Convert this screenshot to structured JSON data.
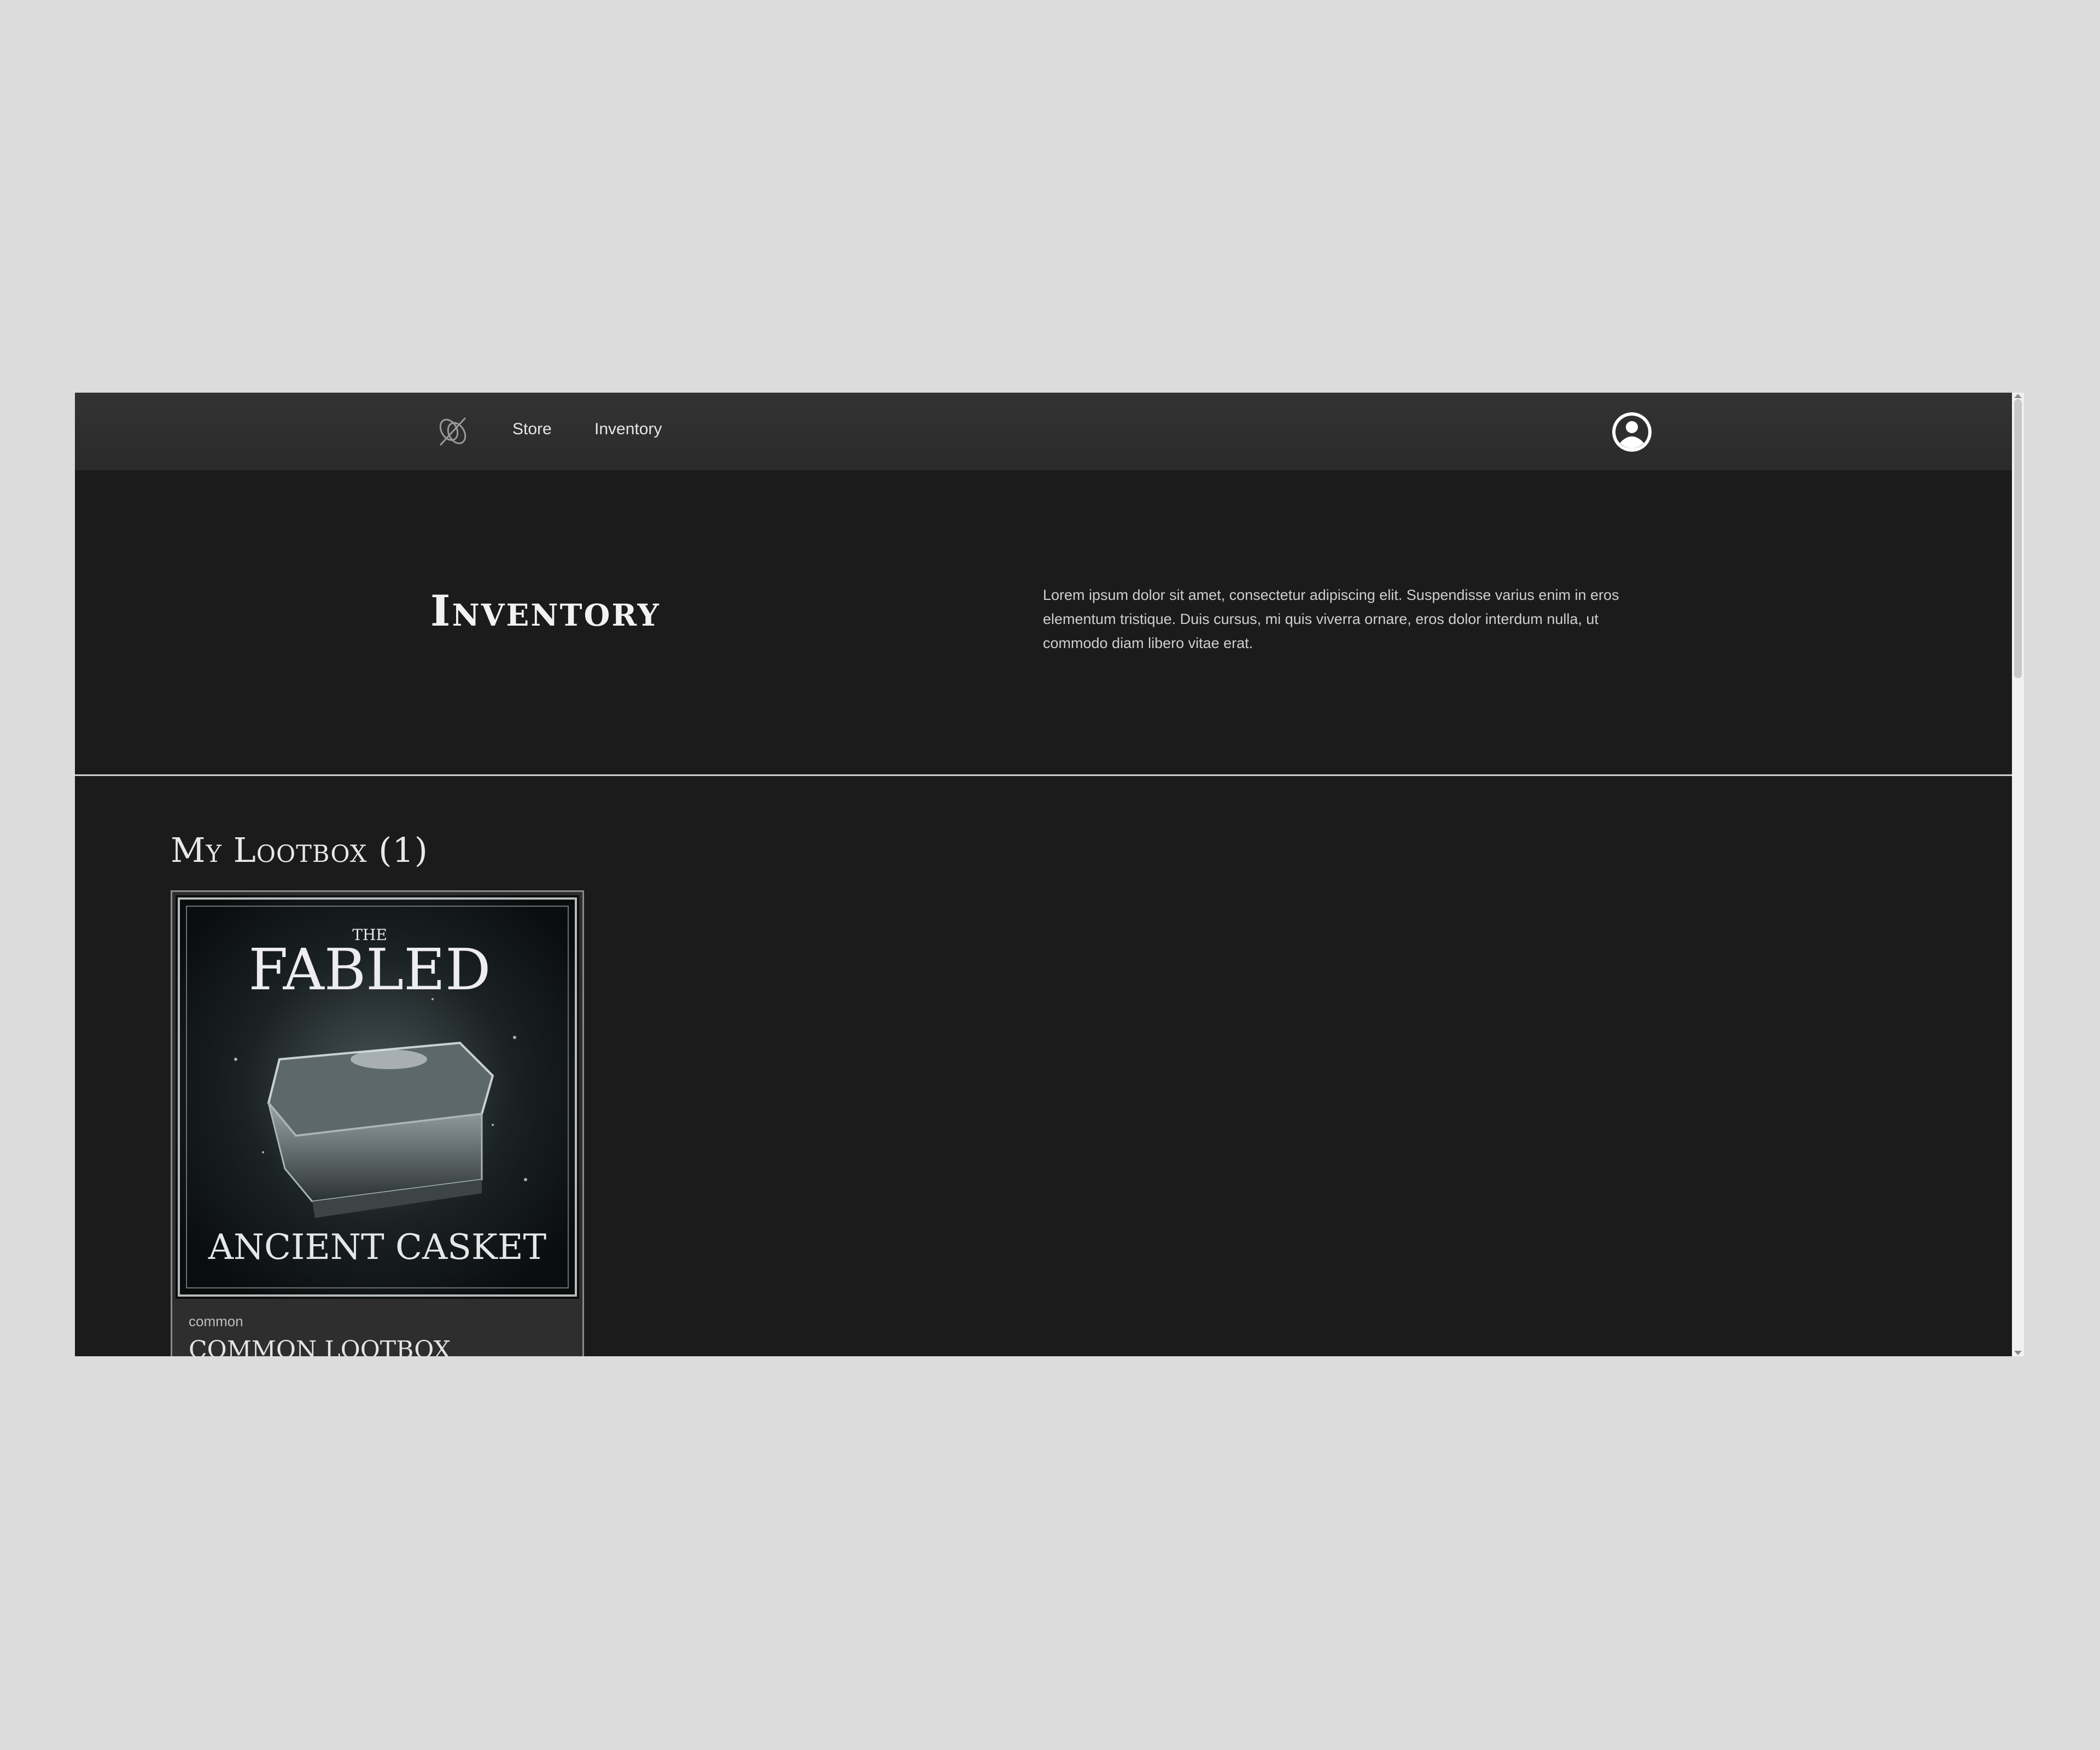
{
  "nav": {
    "logo_icon": "brand-logo-icon",
    "links": [
      {
        "label": "Store"
      },
      {
        "label": "Inventory"
      }
    ],
    "account_icon": "user-circle-icon"
  },
  "hero": {
    "title": "Inventory",
    "description": "Lorem ipsum dolor sit amet, consectetur adipiscing elit. Suspendisse varius enim in eros elementum tristique. Duis cursus, mi quis viverra ornare, eros dolor interdum nulla, ut commodo diam libero vitae erat."
  },
  "lootbox_section": {
    "title": "My Lootbox (1)",
    "items": [
      {
        "art_top_small": "THE",
        "art_top": "FABLED",
        "art_bottom": "ANCIENT CASKET",
        "rarity": "common",
        "name": "COMMON LOOTBOX"
      }
    ]
  },
  "floating": {
    "flower_icon": "flower-icon"
  },
  "colors": {
    "page_bg": "#1c1b1b",
    "nav_bg": "#2e2e2e",
    "outer_bg": "#dcdcdc"
  }
}
